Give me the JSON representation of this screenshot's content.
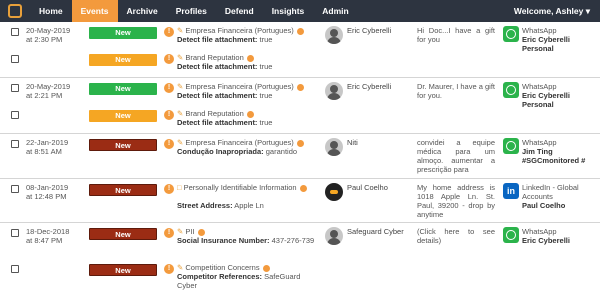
{
  "nav": {
    "items": [
      "Home",
      "Events",
      "Archive",
      "Profiles",
      "Defend",
      "Insights",
      "Admin"
    ],
    "active": "Events",
    "welcome": "Welcome, Ashley ▾"
  },
  "rows": [
    {
      "checkbox": true,
      "date": "20-May-2019",
      "time": "at 2:30 PM",
      "badge": "New",
      "badge_color": "#2bb34b",
      "tag": "Empresa Financeira (Portugues)",
      "detail_label": "Detect file attachment:",
      "detail_value": "true",
      "author": "Eric Cyberelli",
      "message": "Hi Doc...I have a gift for you",
      "source_icon": "whatsapp-icon",
      "source_name": "WhatsApp",
      "source_account": "Eric Cyberelli Personal"
    },
    {
      "checkbox": true,
      "date": "",
      "time": "",
      "badge": "New",
      "badge_color": "#f5a623",
      "tag": "Brand Reputation",
      "detail_label": "Detect file attachment:",
      "detail_value": "true",
      "author": "",
      "message": "",
      "source_icon": "",
      "source_name": "",
      "source_account": ""
    },
    {
      "checkbox": true,
      "date": "20-May-2019",
      "time": "at 2:21 PM",
      "badge": "New",
      "badge_color": "#2bb34b",
      "tag": "Empresa Financeira (Portugues)",
      "detail_label": "Detect file attachment:",
      "detail_value": "true",
      "author": "Eric Cyberelli",
      "message": "Dr. Maurer, I have a gift for you.",
      "source_icon": "whatsapp-icon",
      "source_name": "WhatsApp",
      "source_account": "Eric Cyberelli Personal"
    },
    {
      "checkbox": true,
      "date": "",
      "time": "",
      "badge": "New",
      "badge_color": "#f5a623",
      "tag": "Brand Reputation",
      "detail_label": "Detect file attachment:",
      "detail_value": "true",
      "author": "",
      "message": "",
      "source_icon": "",
      "source_name": "",
      "source_account": ""
    },
    {
      "checkbox": true,
      "date": "22-Jan-2019",
      "time": "at 8:51 AM",
      "badge": "New",
      "badge_color": "#9b2c14",
      "tag": "Empresa Financeira (Portugues)",
      "detail_label": "Condução Inapropriada:",
      "detail_value": "garantido",
      "author": "Niti",
      "message": "convidei a equipe médica para um almoço. aumentar a prescrição para",
      "source_icon": "whatsapp-icon",
      "source_name": "WhatsApp",
      "source_account": "Jim Ting #SGCmonitored #"
    },
    {
      "checkbox": true,
      "date": "08-Jan-2019",
      "time": "at 12:48 PM",
      "badge": "New",
      "badge_color": "#9b2c14",
      "tag": "Personally Identifiable Information",
      "detail_label": "Street Address:",
      "detail_value": "Apple Ln",
      "author": "Paul Coelho",
      "message": "My home address is 1018 Apple Ln. St. Paul, 39200 - drop by anytime",
      "source_icon": "linkedin-icon",
      "source_name": "LinkedIn - Global Accounts",
      "source_account": "Paul Coelho"
    },
    {
      "checkbox": true,
      "date": "18-Dec-2018",
      "time": "at 8:47 PM",
      "badge": "New",
      "badge_color": "#9b2c14",
      "tag": "PII",
      "detail_label": "Social Insurance Number:",
      "detail_value": "437-276-739",
      "author": "Safeguard Cyber",
      "message": "(Click here to see details)",
      "source_icon": "whatsapp-icon",
      "source_name": "WhatsApp",
      "source_account": "Eric Cyberelli"
    },
    {
      "checkbox": true,
      "date": "",
      "time": "",
      "badge": "New",
      "badge_color": "#9b2c14",
      "tag": "Competition Concerns",
      "detail_label": "Competitor References:",
      "detail_value": "SafeGuard Cyber",
      "author": "",
      "message": "",
      "source_icon": "",
      "source_name": "",
      "source_account": ""
    }
  ]
}
